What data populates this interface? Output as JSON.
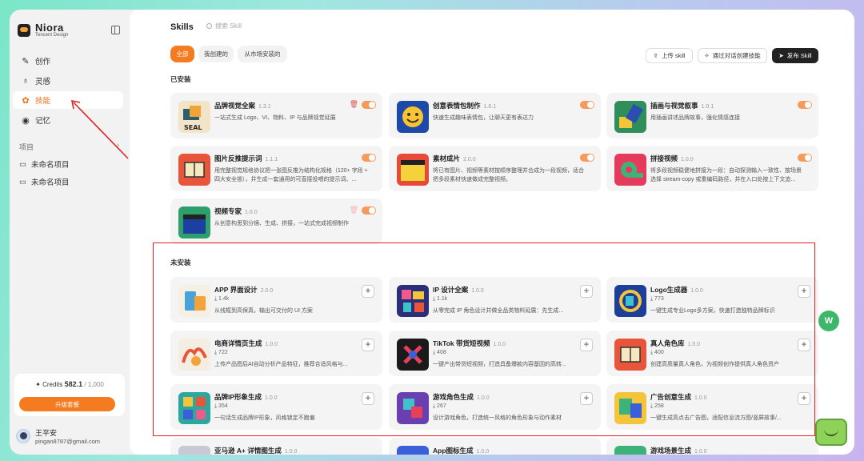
{
  "brand": {
    "name": "Niora",
    "sub": "Tencent Design"
  },
  "nav": [
    {
      "label": "创作",
      "icon": "pen-icon"
    },
    {
      "label": "灵感",
      "icon": "bulb-icon"
    },
    {
      "label": "技能",
      "icon": "skills-icon"
    },
    {
      "label": "记忆",
      "icon": "memory-icon"
    }
  ],
  "projects": {
    "title": "项目",
    "items": [
      "未命名项目",
      "未命名项目"
    ]
  },
  "credits": {
    "label": "Credits",
    "value": "582.1",
    "total": "/ 1,000",
    "upgrade": "升级套餐"
  },
  "user": {
    "name": "王平安",
    "email": "pingan8787@gmail.com"
  },
  "page": {
    "title": "Skills",
    "search_placeholder": "搜索 Skill"
  },
  "filters": [
    "全部",
    "我创建的",
    "从市场安装的"
  ],
  "toolbar": {
    "upload": "上传 skill",
    "chat_create": "通过对话创建技能",
    "publish": "发布 Skill"
  },
  "installed": {
    "title": "已安装",
    "cards": [
      {
        "name": "品牌视觉全案",
        "ver": "1.3.1",
        "desc": "一站式生成 Logo、VI、物料、IP 与品牌视觉延展"
      },
      {
        "name": "创意表情包制作",
        "ver": "1.0.1",
        "desc": "快速生成趣味表情包，让聊天更有表达力"
      },
      {
        "name": "插画与视觉叙事",
        "ver": "1.0.1",
        "desc": "用插画讲述品牌故事，强化情感连接"
      },
      {
        "name": "图片反推提示词",
        "ver": "1.1.1",
        "desc": "用完整视觉规格协议把一张图反推为结构化规格（120+ 字段 + 四大安全锁），并生成一套通用的可直接投喂的提示词、..."
      },
      {
        "name": "素材成片",
        "ver": "2.0.0",
        "desc": "将已有图片、视频等素材按顺序整理并合成为一段视频，适合把多段素材快速做成完整视频。"
      },
      {
        "name": "拼接视频",
        "ver": "1.0.0",
        "desc": "将多段视频稳健地拼接为一段：自动探测输入一致性、按场景选择 stream-copy 或重编码路径，并在入口处按上下文追..."
      },
      {
        "name": "视频专家",
        "ver": "1.6.0",
        "desc": "从创意构思到分镜、生成、拼接，一站式完成视频制作"
      }
    ]
  },
  "uninstalled": {
    "title": "未安装",
    "cards": [
      {
        "name": "APP 界面设计",
        "ver": "2.0.0",
        "downloads": "1.4k",
        "desc": "从线框到高保真，输出可交付的 UI 方案"
      },
      {
        "name": "IP 设计全案",
        "ver": "1.0.0",
        "downloads": "1.1k",
        "desc": "从零完成 IP 角色设计并做全品类物料延展：先生成..."
      },
      {
        "name": "Logo生成器",
        "ver": "1.0.0",
        "downloads": "773",
        "desc": "一键生成专业Logo多方案，快速打造独特品牌标识"
      },
      {
        "name": "电商详情页生成",
        "ver": "1.0.0",
        "downloads": "722",
        "desc": "上传产品图后AI自动分析产品特征，推荐合适风格与..."
      },
      {
        "name": "TikTok 带货短视频",
        "ver": "1.0.0",
        "downloads": "408",
        "desc": "一键产出带货短视频，打造具备爆款内容基因的高转..."
      },
      {
        "name": "真人角色库",
        "ver": "1.0.0",
        "downloads": "400",
        "desc": "创建高质量真人角色，为视频创作提供真人角色资产"
      },
      {
        "name": "品牌IP形象生成",
        "ver": "1.0.0",
        "downloads": "354",
        "desc": "一句话生成品牌IP形象，风格锁定不跑偏"
      },
      {
        "name": "游戏角色生成",
        "ver": "1.0.0",
        "downloads": "267",
        "desc": "设计游戏角色，打造统一风格的角色形象与动作素材"
      },
      {
        "name": "广告创意生成",
        "ver": "1.0.0",
        "downloads": "258",
        "desc": "一键生成高点击广告图，适配信息流方图/竖屏故事/..."
      },
      {
        "name": "亚马逊 A+ 详情图生成",
        "ver": "1.0.0",
        "downloads": "",
        "desc": ""
      },
      {
        "name": "App图标生成",
        "ver": "1.0.0",
        "downloads": "",
        "desc": ""
      },
      {
        "name": "游戏场景生成",
        "ver": "1.0.0",
        "downloads": "",
        "desc": ""
      }
    ]
  },
  "float_button": "W",
  "colors": {
    "accent": "#f47b20",
    "annotation": "#e02020"
  }
}
